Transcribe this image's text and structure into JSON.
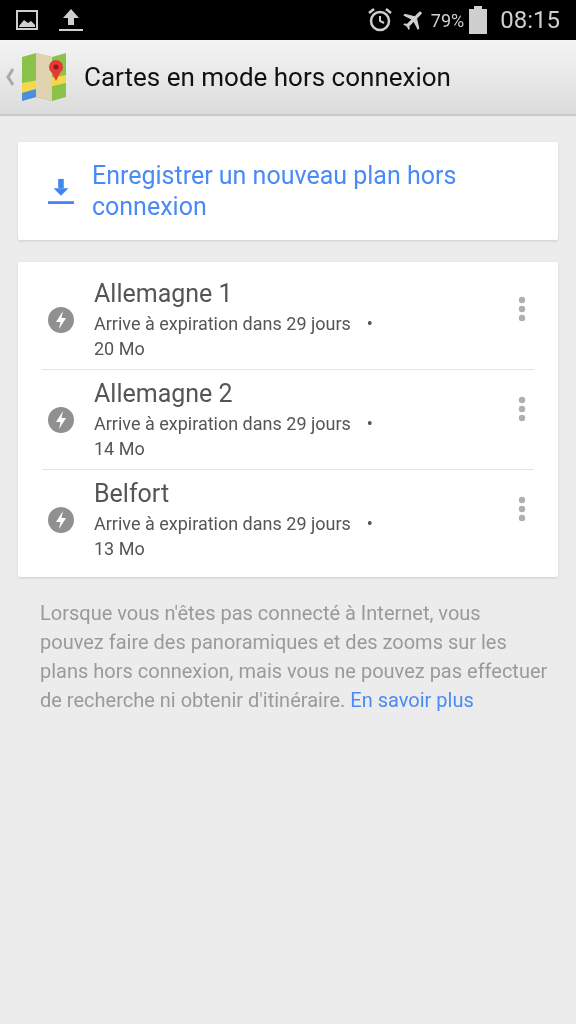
{
  "status_bar": {
    "battery": "79%",
    "time": "08:15"
  },
  "action_bar": {
    "title": "Cartes en mode hors connexion"
  },
  "save_action": {
    "label": "Enregistrer un nouveau plan hors connexion"
  },
  "maps": [
    {
      "name": "Allemagne 1",
      "expiry": "Arrive à expiration dans 29 jours",
      "separator": "•",
      "size": "20 Mo"
    },
    {
      "name": "Allemagne 2",
      "expiry": "Arrive à expiration dans 29 jours",
      "separator": "•",
      "size": "14 Mo"
    },
    {
      "name": "Belfort",
      "expiry": "Arrive à expiration dans 29 jours",
      "separator": "•",
      "size": "13 Mo"
    }
  ],
  "info": {
    "text": "Lorsque vous n'êtes pas connecté à Internet, vous pouvez faire des panoramiques et des zooms sur les plans hors connexion, mais vous ne pouvez pas effectuer de recherche ni obtenir d'itinéraire.",
    "link": "En savoir plus"
  }
}
